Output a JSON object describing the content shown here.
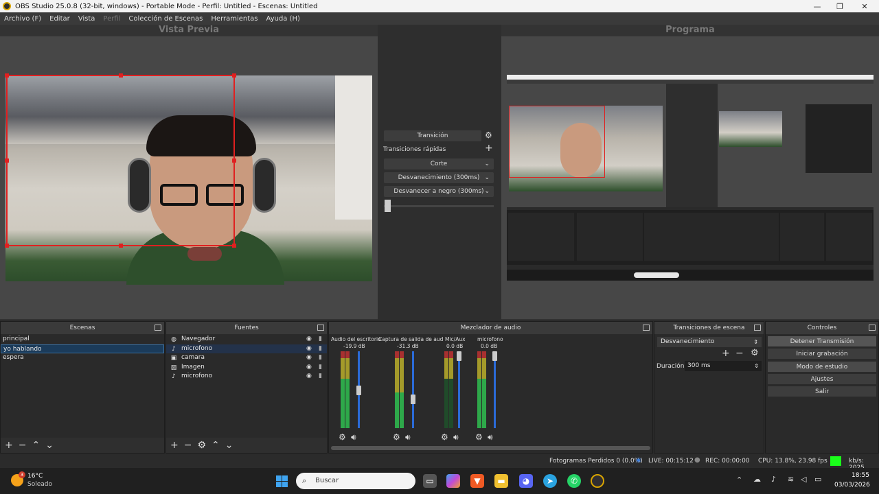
{
  "window": {
    "title": "OBS Studio 25.0.8 (32-bit, windows) - Portable Mode - Perfil: Untitled - Escenas: Untitled",
    "controls": [
      "—",
      "❐",
      "✕"
    ]
  },
  "menu": [
    "Archivo (F)",
    "Editar",
    "Vista",
    "Perfil",
    "Colección de Escenas",
    "Herramientas",
    "Ayuda (H)"
  ],
  "preview": {
    "title": "Vista Previa"
  },
  "program": {
    "title": "Programa"
  },
  "transitions_center": {
    "transition_button": "Transición",
    "quick_transitions": "Transiciones rápidas",
    "items": [
      "Corte",
      "Desvanecimiento (300ms)",
      "Desvanecer a negro (300ms)"
    ]
  },
  "scenes": {
    "title": "Escenas",
    "items": [
      "principal",
      "yo hablando",
      "espera"
    ],
    "selected": 1
  },
  "sources": {
    "title": "Fuentes",
    "items": [
      {
        "name": "Navegador",
        "icon": "globe-icon"
      },
      {
        "name": "microfono",
        "icon": "microphone-icon"
      },
      {
        "name": "camara",
        "icon": "camera-icon"
      },
      {
        "name": "Imagen",
        "icon": "image-icon"
      },
      {
        "name": "microfono",
        "icon": "microphone-icon"
      }
    ]
  },
  "mixer": {
    "title": "Mezclador de audio",
    "channels": [
      {
        "name": "Audio del escritorio",
        "db": "-19.9 dB"
      },
      {
        "name": "Captura de salida de aud",
        "db": "-31.3 dB"
      },
      {
        "name": "Mic/Aux",
        "db": "0.0 dB"
      },
      {
        "name": "microfono",
        "db": "0.0 dB"
      }
    ],
    "scale": [
      "0",
      "-5",
      "-10",
      "-15",
      "-20",
      "-25",
      "-30",
      "-35",
      "-40",
      "-45",
      "-50",
      "-55",
      "-60"
    ]
  },
  "scene_transitions": {
    "title": "Transiciones de escena",
    "selected": "Desvanecimiento",
    "duration_label": "Duración",
    "duration_value": "300 ms"
  },
  "controls": {
    "title": "Controles",
    "buttons": [
      "Detener Transmisión",
      "Iniciar grabación",
      "Modo de estudio",
      "Ajustes",
      "Salir"
    ]
  },
  "status": {
    "dropped": "Fotogramas Perdidos 0 (0.0%)",
    "live": "LIVE: 00:15:12",
    "rec": "REC: 00:00:00",
    "cpu": "CPU: 13.8%, 23.98 fps",
    "kbps": "kb/s: 2025"
  },
  "taskbar": {
    "weather_temp": "16°C",
    "weather_desc": "Soleado",
    "weather_badge": "3",
    "search_placeholder": "Buscar",
    "time": "18:55",
    "date": "03/03/2026"
  },
  "colors": {
    "accent_red": "#e02020",
    "live_green": "#1aff1a",
    "fader_blue": "#2b6bd8"
  }
}
